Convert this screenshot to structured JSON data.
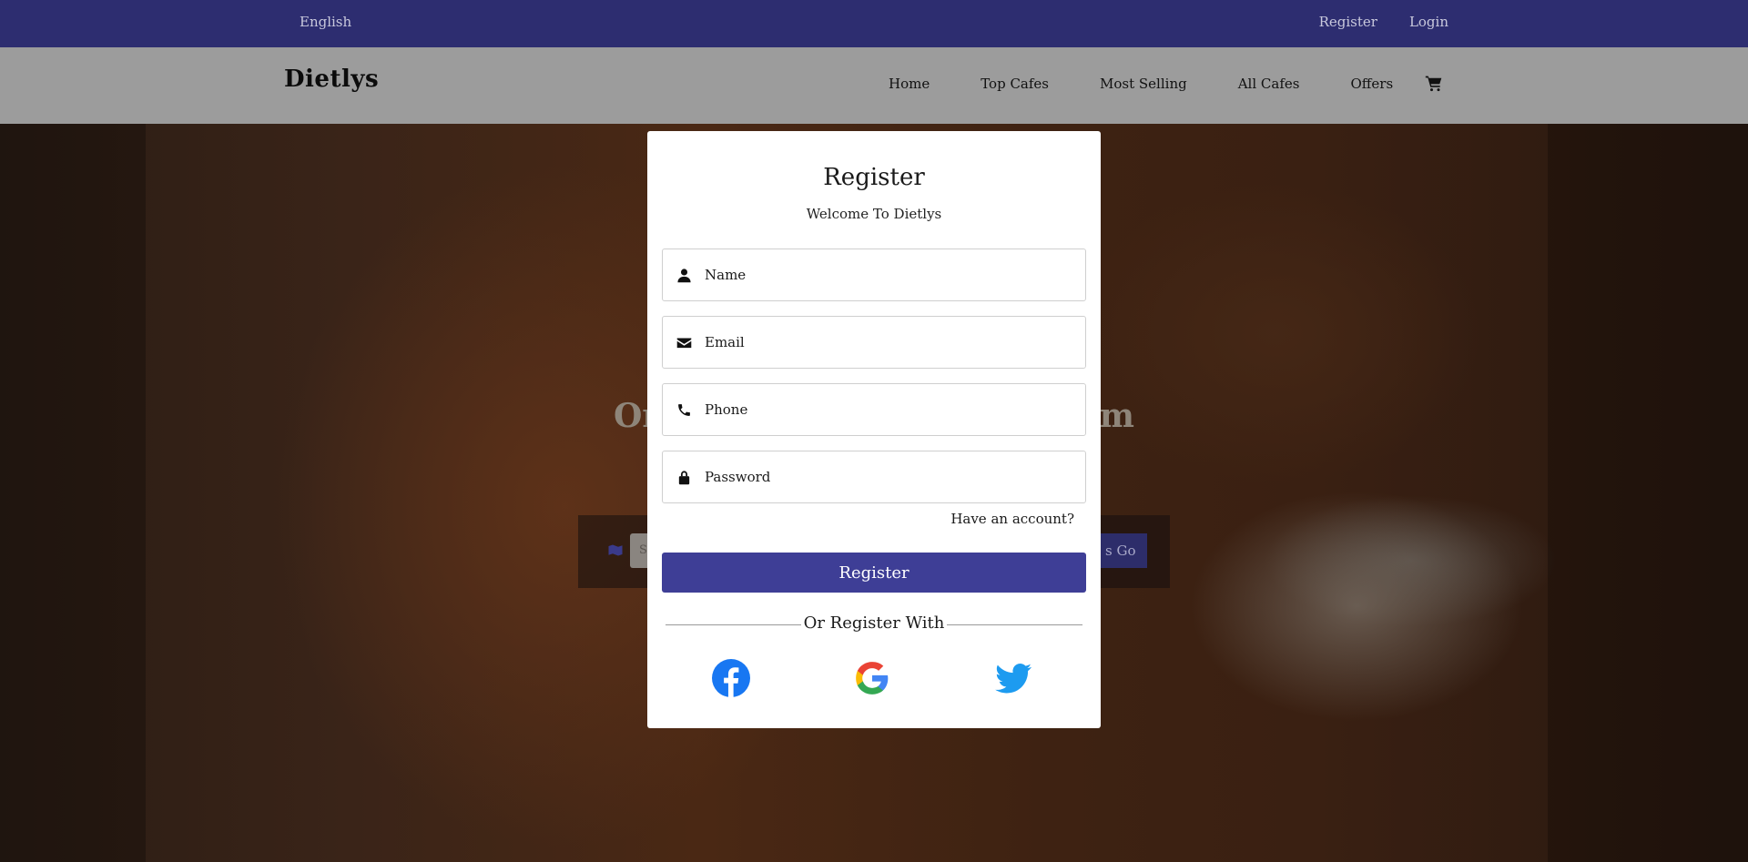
{
  "topbar": {
    "language": "English",
    "register": "Register",
    "login": "Login"
  },
  "navbar": {
    "brand": "Dietlys",
    "links": [
      "Home",
      "Top Cafes",
      "Most Selling",
      "All Cafes",
      "Offers"
    ],
    "cart_icon": "cart-icon"
  },
  "hero": {
    "title_left": "Or",
    "title_right": "om",
    "search_placeholder_fragment": "S",
    "go_label": "s Go",
    "map_icon": "map-icon"
  },
  "modal": {
    "title": "Register",
    "subtitle": "Welcome To Dietlys",
    "fields": [
      {
        "placeholder": "Name",
        "icon": "user-icon"
      },
      {
        "placeholder": "Email",
        "icon": "envelope-icon"
      },
      {
        "placeholder": "Phone",
        "icon": "phone-icon"
      },
      {
        "placeholder": "Password",
        "icon": "lock-icon"
      }
    ],
    "have_account": "Have an account?",
    "register_button": "Register",
    "divider_text": "Or Register With",
    "social": [
      "facebook-icon",
      "google-icon",
      "twitter-icon"
    ]
  },
  "colors": {
    "topbar": "#2d2d70",
    "navbar": "#9c9c9c",
    "accent": "#3e3e96",
    "facebook": "#1877f2",
    "twitter": "#1d9bf0"
  }
}
